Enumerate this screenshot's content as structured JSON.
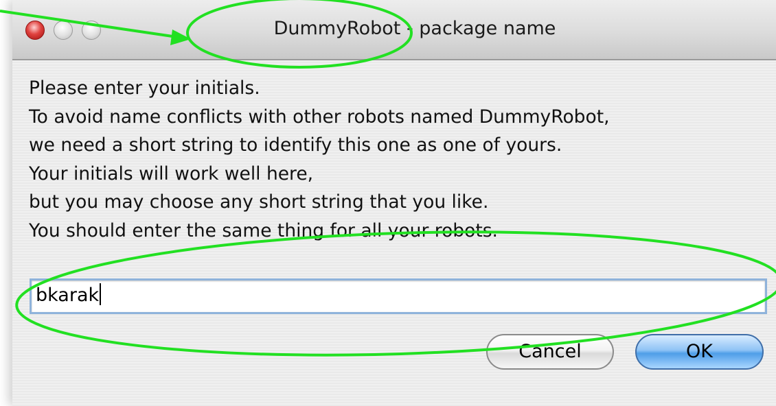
{
  "window": {
    "title": "DummyRobot - package name"
  },
  "message": {
    "lines": [
      "Please enter your initials.",
      "To avoid name conflicts with other robots named DummyRobot,",
      "we need a short string to identify this one as one of yours.",
      "Your initials will work well here,",
      "but you may choose any short string that you like.",
      "You should enter the same thing for all your robots."
    ]
  },
  "input": {
    "value": "bkarak"
  },
  "buttons": {
    "cancel_label": "Cancel",
    "ok_label": "OK"
  },
  "colors": {
    "annotation": "#22e022",
    "close_button": "#e0423f",
    "default_button": "#4f9ee8",
    "focus_ring": "#8fb3db"
  },
  "icons": [
    "close-icon",
    "minimize-icon",
    "zoom-icon"
  ]
}
